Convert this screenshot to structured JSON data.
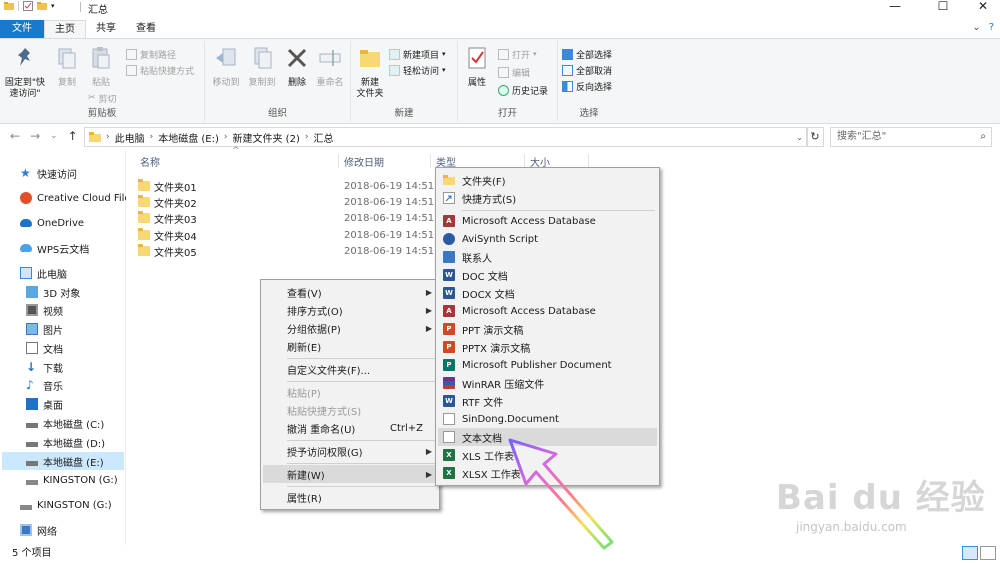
{
  "window": {
    "title": "汇总",
    "minimize": "—",
    "maximize": "☐",
    "close": "✕"
  },
  "ribbon_tabs": [
    {
      "label": "文件"
    },
    {
      "label": "主页"
    },
    {
      "label": "共享"
    },
    {
      "label": "查看"
    }
  ],
  "ribbon": {
    "clipboard": {
      "pin_label": "固定到\"快速访问\"",
      "copy_label": "复制",
      "paste_label": "粘贴",
      "copy_path": "复制路径",
      "paste_shortcut": "粘贴快捷方式",
      "cut": "剪切",
      "group": "剪贴板"
    },
    "organize": {
      "move_to": "移动到",
      "copy_to": "复制到",
      "delete": "删除",
      "rename": "重命名",
      "group": "组织"
    },
    "new": {
      "new_folder": "新建\n文件夹",
      "new_item": "新建项目",
      "easy_access": "轻松访问",
      "group": "新建"
    },
    "open": {
      "properties": "属性",
      "open": "打开",
      "edit": "编辑",
      "history": "历史记录",
      "group": "打开"
    },
    "select": {
      "select_all": "全部选择",
      "select_none": "全部取消",
      "invert": "反向选择",
      "group": "选择"
    }
  },
  "address": {
    "crumbs": [
      "此电脑",
      "本地磁盘 (E:)",
      "新建文件夹 (2)",
      "汇总"
    ],
    "search_placeholder": "搜索\"汇总\""
  },
  "sidebar": {
    "items": [
      {
        "label": "快速访问",
        "icon": "star-icon"
      },
      {
        "label": "Creative Cloud Files",
        "icon": "creative-cloud-icon"
      },
      {
        "label": "OneDrive",
        "icon": "cloud-icon"
      },
      {
        "label": "WPS云文档",
        "icon": "wps-cloud-icon"
      },
      {
        "label": "此电脑",
        "icon": "computer-icon"
      },
      {
        "label": "3D 对象",
        "icon": "cube-icon"
      },
      {
        "label": "视频",
        "icon": "video-icon"
      },
      {
        "label": "图片",
        "icon": "picture-icon"
      },
      {
        "label": "文档",
        "icon": "document-icon"
      },
      {
        "label": "下载",
        "icon": "download-icon"
      },
      {
        "label": "音乐",
        "icon": "music-icon"
      },
      {
        "label": "桌面",
        "icon": "desktop-icon"
      },
      {
        "label": "本地磁盘 (C:)",
        "icon": "drive-icon"
      },
      {
        "label": "本地磁盘 (D:)",
        "icon": "drive-icon"
      },
      {
        "label": "本地磁盘 (E:)",
        "icon": "drive-icon"
      },
      {
        "label": "KINGSTON (G:)",
        "icon": "usb-drive-icon"
      },
      {
        "label": "KINGSTON (G:)",
        "icon": "usb-drive-icon"
      },
      {
        "label": "网络",
        "icon": "network-icon"
      }
    ]
  },
  "columns": {
    "name": "名称",
    "date": "修改日期",
    "type": "类型",
    "size": "大小"
  },
  "files": [
    {
      "name": "文件夹01",
      "date": "2018-06-19 14:51"
    },
    {
      "name": "文件夹02",
      "date": "2018-06-19 14:51"
    },
    {
      "name": "文件夹03",
      "date": "2018-06-19 14:51"
    },
    {
      "name": "文件夹04",
      "date": "2018-06-19 14:51"
    },
    {
      "name": "文件夹05",
      "date": "2018-06-19 14:51"
    }
  ],
  "status": {
    "count": "5 个项目"
  },
  "context_menu": {
    "items": {
      "view": "查看(V)",
      "sort": "排序方式(O)",
      "group": "分组依据(P)",
      "refresh": "刷新(E)",
      "customize": "自定义文件夹(F)...",
      "paste": "粘贴(P)",
      "paste_shortcut": "粘贴快捷方式(S)",
      "undo_rename": "撤消 重命名(U)",
      "undo_shortcut": "Ctrl+Z",
      "grant_access": "授予访问权限(G)",
      "new": "新建(W)",
      "properties": "属性(R)"
    }
  },
  "new_submenu": {
    "folder": "文件夹(F)",
    "shortcut": "快捷方式(S)",
    "items": [
      {
        "label": "Microsoft Access Database",
        "icon": "access-icon",
        "color": "#a4373a"
      },
      {
        "label": "AviSynth Script",
        "icon": "avisynth-icon",
        "color": "#2c5aa0"
      },
      {
        "label": "联系人",
        "icon": "contact-icon",
        "color": "#3a78c3"
      },
      {
        "label": "DOC 文档",
        "icon": "doc-icon",
        "color": "#2b579a"
      },
      {
        "label": "DOCX 文档",
        "icon": "docx-icon",
        "color": "#2b579a"
      },
      {
        "label": "Microsoft Access Database",
        "icon": "access-icon",
        "color": "#a4373a"
      },
      {
        "label": "PPT 演示文稿",
        "icon": "ppt-icon",
        "color": "#d24726"
      },
      {
        "label": "PPTX 演示文稿",
        "icon": "pptx-icon",
        "color": "#d24726"
      },
      {
        "label": "Microsoft Publisher Document",
        "icon": "publisher-icon",
        "color": "#077568"
      },
      {
        "label": "WinRAR 压缩文件",
        "icon": "winrar-icon",
        "color": "#7a2d8c"
      },
      {
        "label": "RTF 文件",
        "icon": "rtf-icon",
        "color": "#2b579a"
      },
      {
        "label": "SinDong.Document",
        "icon": "blank-document-icon",
        "color": "#ffffff"
      },
      {
        "label": "文本文档",
        "icon": "text-document-icon",
        "color": "#ffffff"
      },
      {
        "label": "XLS 工作表",
        "icon": "xls-icon",
        "color": "#217346"
      },
      {
        "label": "XLSX 工作表",
        "icon": "xlsx-icon",
        "color": "#217346"
      }
    ]
  },
  "watermark": {
    "main": "Bai du 经验",
    "sub": "jingyan.baidu.com"
  },
  "colors": {
    "file_tab": "#1979ca",
    "selection": "#cce8ff",
    "folder": "#f8d775"
  }
}
